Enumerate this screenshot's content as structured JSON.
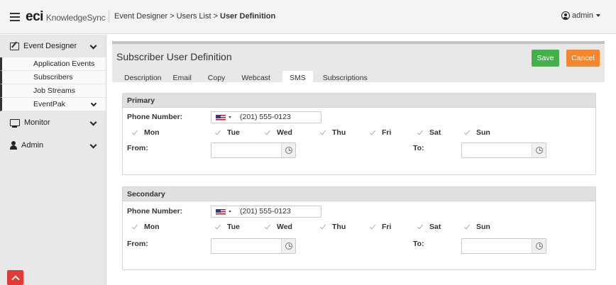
{
  "topbar": {
    "logo_eci": "eci",
    "logo_product": "KnowledgeSync",
    "breadcrumb": [
      "Event Designer",
      "Users List",
      "User Definition"
    ],
    "breadcrumb_sep": ">",
    "user": "admin"
  },
  "sidebar": {
    "event_designer": "Event Designer",
    "application_events": "Application Events",
    "subscribers": "Subscribers",
    "job_streams": "Job Streams",
    "eventpak": "EventPak",
    "monitor": "Monitor",
    "admin": "Admin"
  },
  "main": {
    "title": "Subscriber User Definition",
    "save_label": "Save",
    "cancel_label": "Cancel",
    "tabs": [
      "Description",
      "Email",
      "Copy",
      "Webcast",
      "SMS",
      "Subscriptions"
    ],
    "active_tab": "SMS"
  },
  "primary": {
    "heading": "Primary",
    "phone_label": "Phone Number:",
    "phone_value": "(201) 555-0123",
    "days": [
      "Mon",
      "Tue",
      "Wed",
      "Thu",
      "Fri",
      "Sat",
      "Sun"
    ],
    "from_label": "From:",
    "to_label": "To:"
  },
  "secondary": {
    "heading": "Secondary",
    "phone_label": "Phone Number:",
    "phone_value": "(201) 555-0123",
    "days": [
      "Mon",
      "Tue",
      "Wed",
      "Thu",
      "Fri",
      "Sat",
      "Sun"
    ],
    "from_label": "From:",
    "to_label": "To:"
  },
  "colors": {
    "save": "#43b14a",
    "cancel": "#f5862e",
    "scroll_top": "#e53935"
  },
  "icons": [
    "menu-icon",
    "user-icon",
    "edit-icon",
    "monitor-icon",
    "admin-icon",
    "flag-us-icon",
    "check-icon",
    "clock-icon",
    "chevron-down-icon",
    "chevron-up-icon"
  ]
}
